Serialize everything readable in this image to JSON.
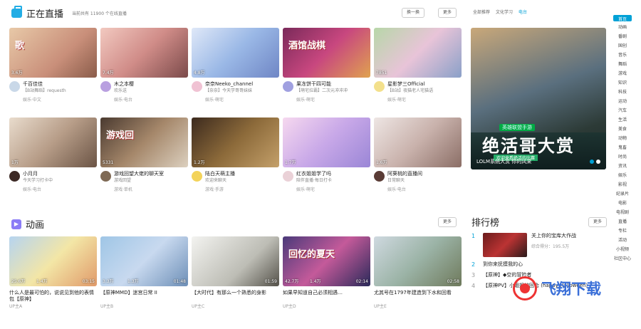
{
  "live": {
    "title": "正在直播",
    "subtitle": "当前共有 11900 个在线直播",
    "refresh_label": "换一换",
    "more_label": "更多",
    "tabs": [
      "全部推荐",
      "文化学习",
      "电台",
      "全部推荐"
    ],
    "cards": [
      {
        "viewers": "3.6万",
        "name": "千百佳佳",
        "desc": "【B站舞蹈】requesth",
        "tag": "娱乐·中文",
        "overlay": "歌",
        "bg": "linear-gradient(135deg,#e8c9a8,#c98f7a 60%,#8a5c4a)",
        "av": "#c9d8e8"
      },
      {
        "viewers": "7.4万",
        "name": "木之本樱",
        "desc": "欢乐送",
        "tag": "娱乐·电台",
        "overlay": "",
        "bg": "linear-gradient(135deg,#f2c9c0,#d08c88 50%,#7b4a4a)",
        "av": "#b9a0e0"
      },
      {
        "viewers": "4.8万",
        "name": "奈奈Neeko_channel",
        "desc": "【奈奈】今天学哥哥妹妹",
        "tag": "娱乐·萌宅",
        "overlay": "",
        "bg": "linear-gradient(135deg,#dfe8f8,#9ab8e6 50%,#6f86c5)",
        "av": "#f0c2d3"
      },
      {
        "viewers": "",
        "name": "果冻饼干四可能",
        "desc": "【萌宅拉霸】二次元冲冲冲",
        "tag": "娱乐·萌宅",
        "overlay": "酒馆战棋",
        "bg": "linear-gradient(135deg,#7a2a5a,#c8477f 50%,#e0a24f)",
        "av": "#a0a0e0"
      },
      {
        "viewers": "7851",
        "name": "星影梦三Official",
        "desc": "【B站】夜猫老人宅猫语",
        "tag": "娱乐·萌宅",
        "overlay": "",
        "bg": "linear-gradient(135deg,#b7d7a8,#e8c4d8 50%,#8aa0c8)",
        "av": "#f3e08c"
      },
      {
        "viewers": "1万",
        "name": "小月月",
        "desc": "今天学习打卡中",
        "tag": "娱乐·电台",
        "overlay": "",
        "bg": "linear-gradient(135deg,#e9dccd,#b79d88 50%,#6b5445)",
        "av": "#3d2a26"
      },
      {
        "viewers": "5331",
        "name": "游戏回望大佬的聊天室",
        "desc": "游戏回望",
        "tag": "游戏·单机",
        "overlay": "游戏回",
        "bg": "linear-gradient(135deg,#4a3a30,#a5876a 50%,#dcd0bf)",
        "av": "#7f6a55"
      },
      {
        "viewers": "1.2万",
        "name": "陆白天萌主播",
        "desc": "欢迎来聊天",
        "tag": "游戏·手游",
        "overlay": "",
        "bg": "linear-gradient(135deg,#3c2a1e,#8c6a3a 50%,#c4a06a)",
        "av": "#f3d35a"
      },
      {
        "viewers": "1.7万",
        "name": "红衣姐姐学了吗",
        "desc": "陪伴直播·每日打卡",
        "tag": "娱乐·萌宅",
        "overlay": "",
        "bg": "linear-gradient(135deg,#f6d8ef,#c8a8e8 50%,#9a86d6)",
        "av": "#ead1d7"
      },
      {
        "viewers": "1.6万",
        "name": "阿葵桃的直播间",
        "desc": "日常聊天",
        "tag": "娱乐·电台",
        "overlay": "",
        "bg": "linear-gradient(135deg,#eee6e4,#c9b2ac 50%,#8b6e66)",
        "av": "#5a3c36"
      }
    ],
    "banner": {
      "badge": "英雄联盟手游",
      "slogan": "绝活哥大赏",
      "sub": "欢迎来看绝活的比赛",
      "caption": "LOLM系统大赏 你的风采"
    }
  },
  "anime": {
    "title": "动画",
    "more_label": "更多",
    "cards": [
      {
        "plays": "25.6万",
        "likes": "1.4万",
        "dur": "03:15",
        "title": "什么人是最可怕的，说说见到他的表情包【原神】",
        "up": "UP主A",
        "bg": "linear-gradient(135deg,#b6d4f0,#f3e6a6 50%,#e09a6a)"
      },
      {
        "plays": "3.3万",
        "likes": "1.3万",
        "dur": "01:48",
        "title": "【原神MMD】迷宫日常 II",
        "up": "UP主B",
        "bg": "linear-gradient(135deg,#9fc6e6,#c8d9ef 50%,#6d8fb7)"
      },
      {
        "plays": "",
        "likes": "",
        "dur": "01:59",
        "title": "【大时代】有那么一个熟悉的身影",
        "up": "UP主C",
        "bg": "linear-gradient(135deg,#f3f3f0,#bdbdb5 60%,#55524a)"
      },
      {
        "plays": "42.7万",
        "likes": "1.4万",
        "dur": "02:14",
        "title": "如果早知道自己必须相遇…",
        "up": "UP主D",
        "bg": "linear-gradient(135deg,#4a3a7a,#c45a9a 50%,#2a2a5a)",
        "overlay": "回忆的夏天"
      },
      {
        "plays": "",
        "likes": "",
        "dur": "02:58",
        "title": "尤其号在1797年建造到下水和回看",
        "up": "UP主E",
        "bg": "linear-gradient(135deg,#cfd9e0,#9bb3a6 50%,#6f7a5c)"
      }
    ]
  },
  "ranking": {
    "title": "排行榜",
    "more_label": "更多",
    "items": [
      {
        "num": "1",
        "title": "关上你的宝库大作战",
        "plays": "综合得分：195.5万"
      },
      {
        "num": "2",
        "title": "到你来抚摸我的心"
      },
      {
        "num": "3",
        "title": "【原神】◆空的冒险者"
      },
      {
        "num": "4",
        "title": "【原神PV】小姐姐的回合 (happy Halloween)"
      }
    ]
  },
  "sidebar": [
    "首页",
    "动画",
    "番剧",
    "国创",
    "音乐",
    "舞蹈",
    "游戏",
    "知识",
    "科技",
    "运动",
    "汽车",
    "生活",
    "美食",
    "动物",
    "鬼畜",
    "时尚",
    "资讯",
    "娱乐",
    "影视",
    "纪录片",
    "电影",
    "电视剧",
    "直播",
    "专栏",
    "活动",
    "小视频",
    "社区中心"
  ],
  "watermark": "飞翔下载"
}
